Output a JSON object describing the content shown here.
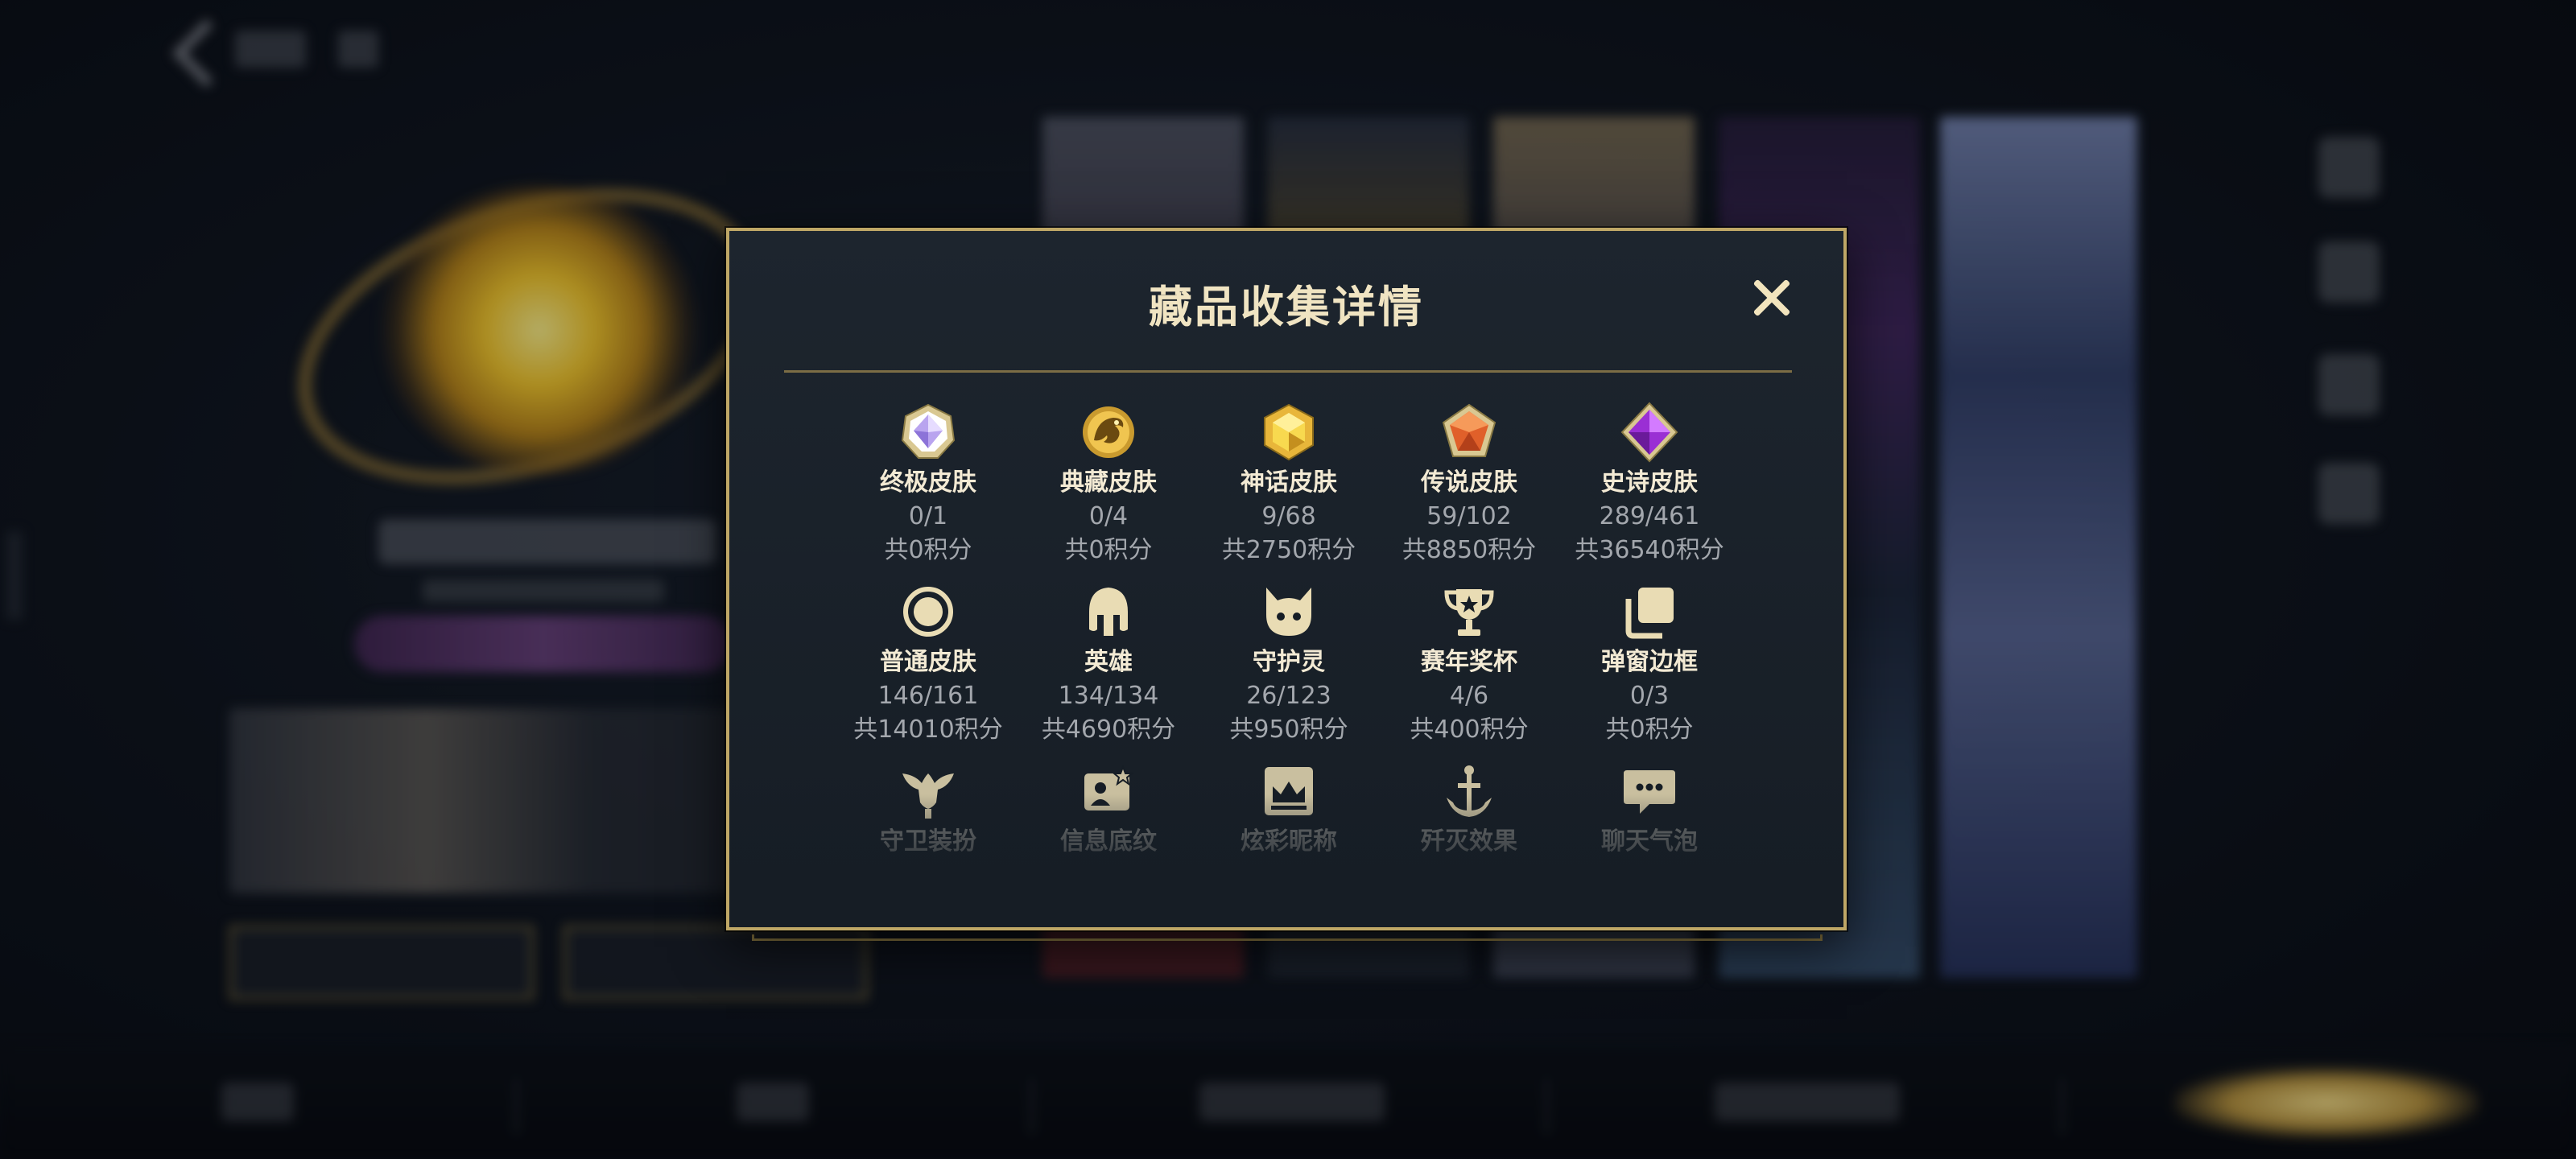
{
  "dialog": {
    "title": "藏品收集详情",
    "close_icon": "close-icon"
  },
  "rows": [
    [
      {
        "icon": "ultimate-skin-gem-icon",
        "name": "终极皮肤",
        "count": "0/1",
        "points": "共0积分"
      },
      {
        "icon": "collector-skin-dragon-icon",
        "name": "典藏皮肤",
        "count": "0/4",
        "points": "共0积分"
      },
      {
        "icon": "mythic-skin-gem-icon",
        "name": "神话皮肤",
        "count": "9/68",
        "points": "共2750积分"
      },
      {
        "icon": "legendary-skin-gem-icon",
        "name": "传说皮肤",
        "count": "59/102",
        "points": "共8850积分"
      },
      {
        "icon": "epic-skin-gem-icon",
        "name": "史诗皮肤",
        "count": "289/461",
        "points": "共36540积分"
      }
    ],
    [
      {
        "icon": "normal-skin-circle-icon",
        "name": "普通皮肤",
        "count": "146/161",
        "points": "共14010积分"
      },
      {
        "icon": "hero-helmet-icon",
        "name": "英雄",
        "count": "134/134",
        "points": "共4690积分"
      },
      {
        "icon": "guardian-spirit-icon",
        "name": "守护灵",
        "count": "26/123",
        "points": "共950积分"
      },
      {
        "icon": "season-trophy-icon",
        "name": "赛年奖杯",
        "count": "4/6",
        "points": "共400积分"
      },
      {
        "icon": "popup-frame-icon",
        "name": "弹窗边框",
        "count": "0/3",
        "points": "共0积分"
      }
    ],
    [
      {
        "icon": "guard-outfit-icon",
        "name": "守卫装扮"
      },
      {
        "icon": "info-background-icon",
        "name": "信息底纹"
      },
      {
        "icon": "colorful-nickname-icon",
        "name": "炫彩昵称"
      },
      {
        "icon": "elimination-effect-icon",
        "name": "歼灭效果"
      },
      {
        "icon": "chat-bubble-icon",
        "name": "聊天气泡"
      }
    ]
  ],
  "colors": {
    "gold_border": "#bfa766",
    "title": "#f0e4c2",
    "icon_gold": "#e9dcb4",
    "muted_text": "#a3a7ad"
  }
}
